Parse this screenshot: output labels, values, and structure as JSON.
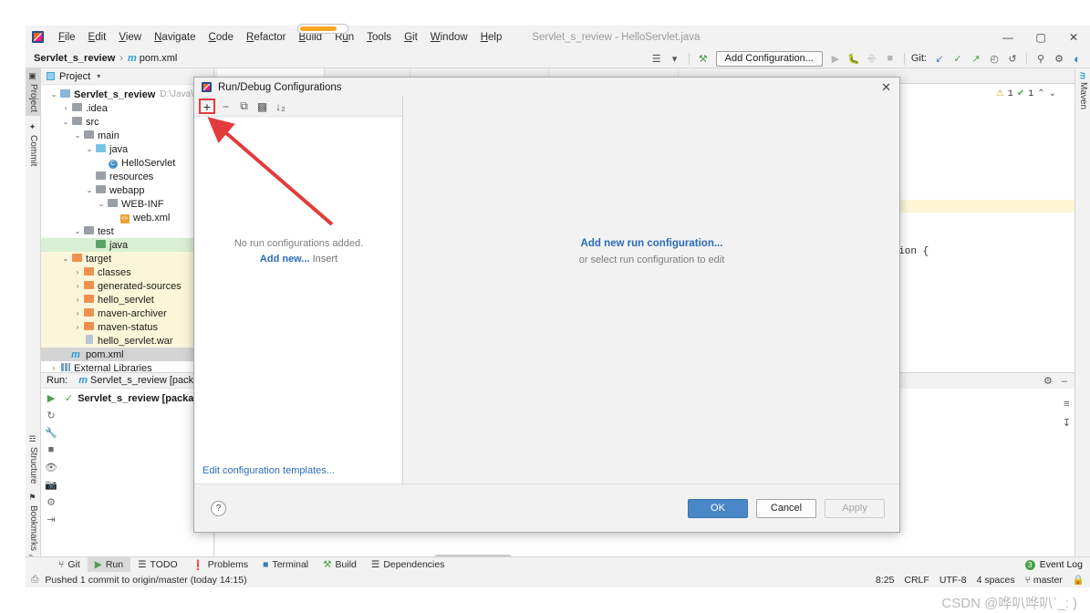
{
  "window": {
    "title": "Servlet_s_review - HelloServlet.java",
    "minimize": "—",
    "maximize": "▢",
    "close": "✕"
  },
  "menu": [
    {
      "label": "File"
    },
    {
      "label": "Edit"
    },
    {
      "label": "View"
    },
    {
      "label": "Navigate"
    },
    {
      "label": "Code"
    },
    {
      "label": "Refactor"
    },
    {
      "label": "Build"
    },
    {
      "label": "Run"
    },
    {
      "label": "Tools"
    },
    {
      "label": "Git"
    },
    {
      "label": "Window"
    },
    {
      "label": "Help"
    }
  ],
  "navbar": {
    "project": "Servlet_s_review",
    "separator": "›",
    "maven_glyph": "m",
    "file": "pom.xml",
    "add_configuration": "Add Configuration...",
    "git_label": "Git:",
    "profile_icon": "☰",
    "dropdown_caret": "▾",
    "build_hammer": "⚒",
    "run_icon": "▶",
    "debug_icon": "ὁE",
    "coverage_icon": "⬡",
    "stop_icon": "■",
    "update_icon": "↙",
    "commit_icon": "✓",
    "push_icon": "↗",
    "history_icon": "◴",
    "rollback_icon": "↺",
    "search_icon": "⚲",
    "settings_icon": "⚙",
    "avatar_icon": "◖"
  },
  "left_strip": [
    {
      "label": "Project",
      "icon": "▣",
      "active": true
    },
    {
      "label": "Commit",
      "icon": "✦",
      "active": false
    },
    {
      "label": "Structure",
      "icon": "☲",
      "active": false
    },
    {
      "label": "Bookmarks",
      "icon": "⚑",
      "active": false
    }
  ],
  "left_strip_more": "»",
  "right_strip": [
    {
      "label": "Maven",
      "icon": "m"
    }
  ],
  "project_panel": {
    "header": "Project",
    "header_caret": "▾",
    "tree": [
      {
        "depth": 0,
        "arrow": "⌄",
        "icon": "module",
        "label": "Servlet_s_review",
        "path": "D:\\Java\\code",
        "bold": true,
        "state": ""
      },
      {
        "depth": 1,
        "arrow": "›",
        "icon": "gray",
        "label": ".idea",
        "path": "",
        "bold": false,
        "state": ""
      },
      {
        "depth": 1,
        "arrow": "⌄",
        "icon": "gray",
        "label": "src",
        "path": "",
        "bold": false,
        "state": ""
      },
      {
        "depth": 2,
        "arrow": "⌄",
        "icon": "gray",
        "label": "main",
        "path": "",
        "bold": false,
        "state": ""
      },
      {
        "depth": 3,
        "arrow": "⌄",
        "icon": "lightblue",
        "label": "java",
        "path": "",
        "bold": false,
        "state": ""
      },
      {
        "depth": 4,
        "arrow": "",
        "icon": "class",
        "label": "HelloServlet",
        "path": "",
        "bold": false,
        "state": ""
      },
      {
        "depth": 3,
        "arrow": "",
        "icon": "resources",
        "label": "resources",
        "path": "",
        "bold": false,
        "state": ""
      },
      {
        "depth": 3,
        "arrow": "⌄",
        "icon": "gray",
        "label": "webapp",
        "path": "",
        "bold": false,
        "state": ""
      },
      {
        "depth": 4,
        "arrow": "⌄",
        "icon": "gray",
        "label": "WEB-INF",
        "path": "",
        "bold": false,
        "state": ""
      },
      {
        "depth": 5,
        "arrow": "",
        "icon": "xml",
        "label": "web.xml",
        "path": "",
        "bold": false,
        "state": ""
      },
      {
        "depth": 2,
        "arrow": "⌄",
        "icon": "gray",
        "label": "test",
        "path": "",
        "bold": false,
        "state": ""
      },
      {
        "depth": 3,
        "arrow": "",
        "icon": "green",
        "label": "java",
        "path": "",
        "bold": false,
        "state": "hl-green"
      },
      {
        "depth": 1,
        "arrow": "⌄",
        "icon": "orange",
        "label": "target",
        "path": "",
        "bold": false,
        "state": "hl-yellow"
      },
      {
        "depth": 2,
        "arrow": "›",
        "icon": "orange",
        "label": "classes",
        "path": "",
        "bold": false,
        "state": "hl-yellow"
      },
      {
        "depth": 2,
        "arrow": "›",
        "icon": "orange",
        "label": "generated-sources",
        "path": "",
        "bold": false,
        "state": "hl-yellow"
      },
      {
        "depth": 2,
        "arrow": "›",
        "icon": "orange",
        "label": "hello_servlet",
        "path": "",
        "bold": false,
        "state": "hl-yellow"
      },
      {
        "depth": 2,
        "arrow": "›",
        "icon": "orange",
        "label": "maven-archiver",
        "path": "",
        "bold": false,
        "state": "hl-yellow"
      },
      {
        "depth": 2,
        "arrow": "›",
        "icon": "orange",
        "label": "maven-status",
        "path": "",
        "bold": false,
        "state": "hl-yellow"
      },
      {
        "depth": 2,
        "arrow": "",
        "icon": "war",
        "label": "hello_servlet.war",
        "path": "",
        "bold": false,
        "state": "hl-yellow"
      },
      {
        "depth": 1,
        "arrow": "",
        "icon": "mvn",
        "label": "pom.xml",
        "path": "",
        "bold": false,
        "state": "sel"
      },
      {
        "depth": 0,
        "arrow": "›",
        "icon": "lib",
        "label": "External Libraries",
        "path": "",
        "bold": false,
        "state": ""
      }
    ]
  },
  "run_panel": {
    "label": "Run:",
    "config_icon": "m",
    "config_name": "Servlet_s_review [package",
    "result_check": "✓",
    "result_text": "Servlet_s_review [packag",
    "tool_icons": [
      "▶",
      "↺",
      "ὒ7",
      "■",
      "◉",
      "὏7",
      "⚙",
      "→"
    ]
  },
  "editor": {
    "code_fragment": "OException {",
    "warning_icon": "⚠",
    "warning_count": "1",
    "ok_icon": "✔",
    "ok_count": "1",
    "up_caret": "⌃",
    "down_caret": "⌄"
  },
  "dialog": {
    "title": "Run/Debug Configurations",
    "close": "✕",
    "toolbar": {
      "add": "+",
      "remove": "−",
      "copy": "⧉",
      "folder": "▰",
      "sort": "↓₁"
    },
    "empty_title": "No run configurations added.",
    "empty_link": "Add new...",
    "empty_shortcut": "Insert",
    "right_title": "Add new run configuration...",
    "right_subtitle": "or select run configuration to edit",
    "edit_templates": "Edit configuration templates...",
    "help": "?",
    "ok": "OK",
    "cancel": "Cancel",
    "apply": "Apply"
  },
  "tool_windows": [
    {
      "label": "Git",
      "icon": "⑂",
      "active": false
    },
    {
      "label": "Run",
      "icon": "▶",
      "active": true
    },
    {
      "label": "TODO",
      "icon": "☰",
      "active": false
    },
    {
      "label": "Problems",
      "icon": "❗",
      "active": false
    },
    {
      "label": "Terminal",
      "icon": "⬛",
      "active": false
    },
    {
      "label": "Build",
      "icon": "⚒",
      "active": false
    },
    {
      "label": "Dependencies",
      "icon": "☰",
      "active": false
    }
  ],
  "event_log": {
    "label": "Event Log",
    "count": "3"
  },
  "status_bar": {
    "message": "Pushed 1 commit to origin/master (today 14:15)",
    "caret_position": "8:25",
    "line_separator": "CRLF",
    "encoding": "UTF-8",
    "indent": "4 spaces",
    "branch_icon": "⑂",
    "branch": "master",
    "lock_icon": "ὑ2"
  },
  "watermark": "CSDN @哗叭哗叭`_: )",
  "colors": {
    "accent_blue": "#2b6cb8",
    "primary_button": "#4a87c8",
    "annotation_red": "#e23b3b",
    "highlight_green": "#d8efd3",
    "highlight_yellow": "#fbf6d9",
    "folder_orange": "#f09050"
  }
}
